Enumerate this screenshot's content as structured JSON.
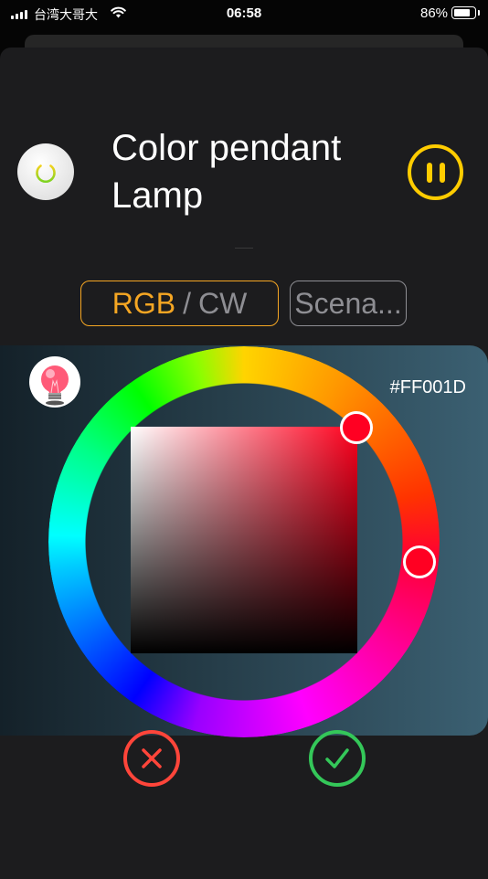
{
  "status_bar": {
    "carrier": "台湾大哥大",
    "time": "06:58",
    "battery_percent": "86%"
  },
  "header": {
    "title_line1": "Color pendant",
    "title_line2": "Lamp"
  },
  "mode_tabs": {
    "rgb_label": "RGB",
    "separator": "/",
    "cw_label": "CW",
    "scene_label": "Scena..."
  },
  "color_picker": {
    "hex_value": "#FF001D",
    "selected_color": "#FF001D"
  },
  "colors": {
    "accent_orange": "#F5A623",
    "pause_yellow": "#FFCC00",
    "cancel_red": "#FF453A",
    "confirm_green": "#34C759"
  },
  "icons": {
    "power": "power-icon",
    "pause": "pause-icon",
    "bulb": "bulb-icon",
    "cancel": "close-icon",
    "confirm": "checkmark-icon"
  }
}
